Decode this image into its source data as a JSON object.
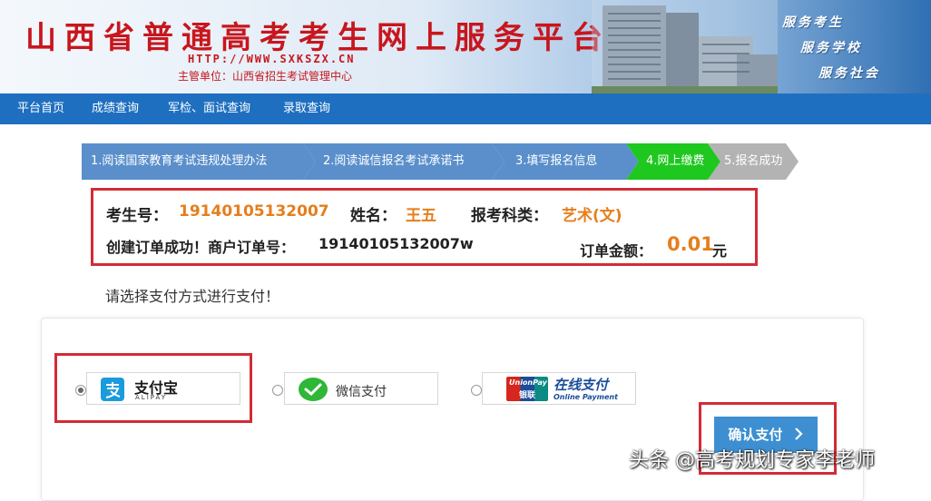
{
  "header": {
    "title": "山西省普通高考考生网上服务平台",
    "url": "HTTP://WWW.SXKSZX.CN",
    "sponsor": "主管单位：山西省招生考试管理中心",
    "slogans": [
      "服务考生",
      "服务学校",
      "服务社会"
    ]
  },
  "nav": {
    "items": [
      "平台首页",
      "成绩查询",
      "军检、面试查询",
      "录取查询"
    ]
  },
  "steps": [
    "1.阅读国家教育考试违规处理办法",
    "2.阅读诚信报名考试承诺书",
    "3.填写报名信息",
    "4.网上缴费",
    "5.报名成功"
  ],
  "info": {
    "exam_no_label": "考生号：",
    "exam_no": "19140105132007",
    "name_label": "姓名：",
    "name": "王五",
    "category_label": "报考科类：",
    "category": "艺术(文)",
    "order_label": "创建订单成功！商户订单号：",
    "order_no": "19140105132007w",
    "amount_label": "订单金额：",
    "amount": "0.01",
    "amount_unit": "元"
  },
  "prompt": "请选择支付方式进行支付！",
  "payment": {
    "alipay": {
      "cn": "支付宝",
      "en": "ALIPAY",
      "selected": true
    },
    "wechat": {
      "label": "微信支付",
      "selected": false
    },
    "unionpay": {
      "logo_top": "UnionPay",
      "logo_bottom": "银联",
      "title": "在线支付",
      "subtitle": "Online Payment",
      "selected": false
    }
  },
  "confirm_label": "确认支付",
  "confirm_icon": "chevron-right-icon",
  "watermark": "头条 @高考规划专家李老师",
  "colors": {
    "nav": "#1e6fc0",
    "step_done": "#5a8fcb",
    "step_active": "#1ec81e",
    "step_todo": "#b3b3b3",
    "highlight_frame": "#d22c36",
    "value": "#e57e1c",
    "confirm": "#3d8fd1"
  }
}
